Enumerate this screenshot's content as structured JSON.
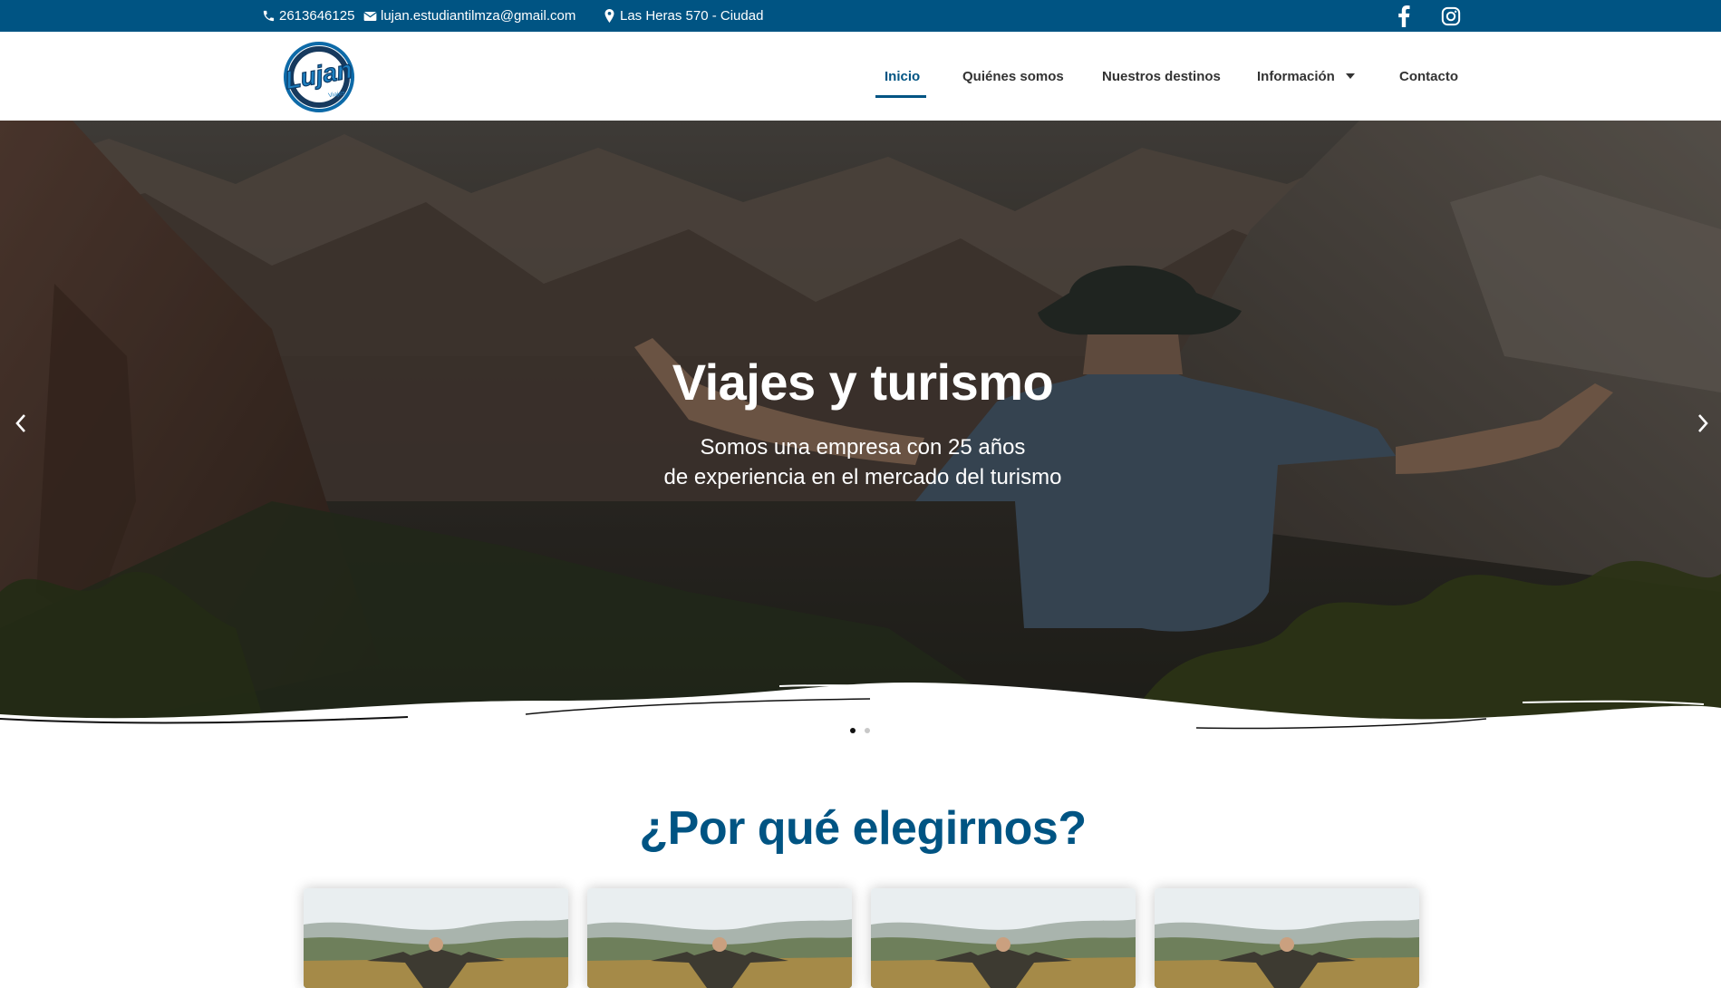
{
  "topbar": {
    "phone": "2613646125",
    "email": "lujan.estudiantilmza@gmail.com",
    "address": "Las Heras 570 - Ciudad",
    "icons": [
      "phone-icon",
      "mail-icon",
      "map-pin-icon",
      "facebook-icon",
      "instagram-icon"
    ],
    "background_color": "#005483"
  },
  "header": {
    "logo_text": "Lujan",
    "logo_sub": "Viajes",
    "nav": {
      "inicio": "Inicio",
      "quienes": "Quiénes somos",
      "destinos": "Nuestros destinos",
      "informacion": "Información",
      "contacto": "Contacto"
    },
    "active_item": "Inicio"
  },
  "hero": {
    "title": "Viajes y turismo",
    "subtitle_line1": "Somos una empresa con 25 años",
    "subtitle_line2": "de experiencia en el mercado del turismo",
    "slides_total": 2,
    "active_slide": 1
  },
  "section": {
    "title": "¿Por qué elegirnos?",
    "cards_count": 4
  },
  "colors": {
    "brand": "#005483",
    "text_dark": "#333333"
  }
}
